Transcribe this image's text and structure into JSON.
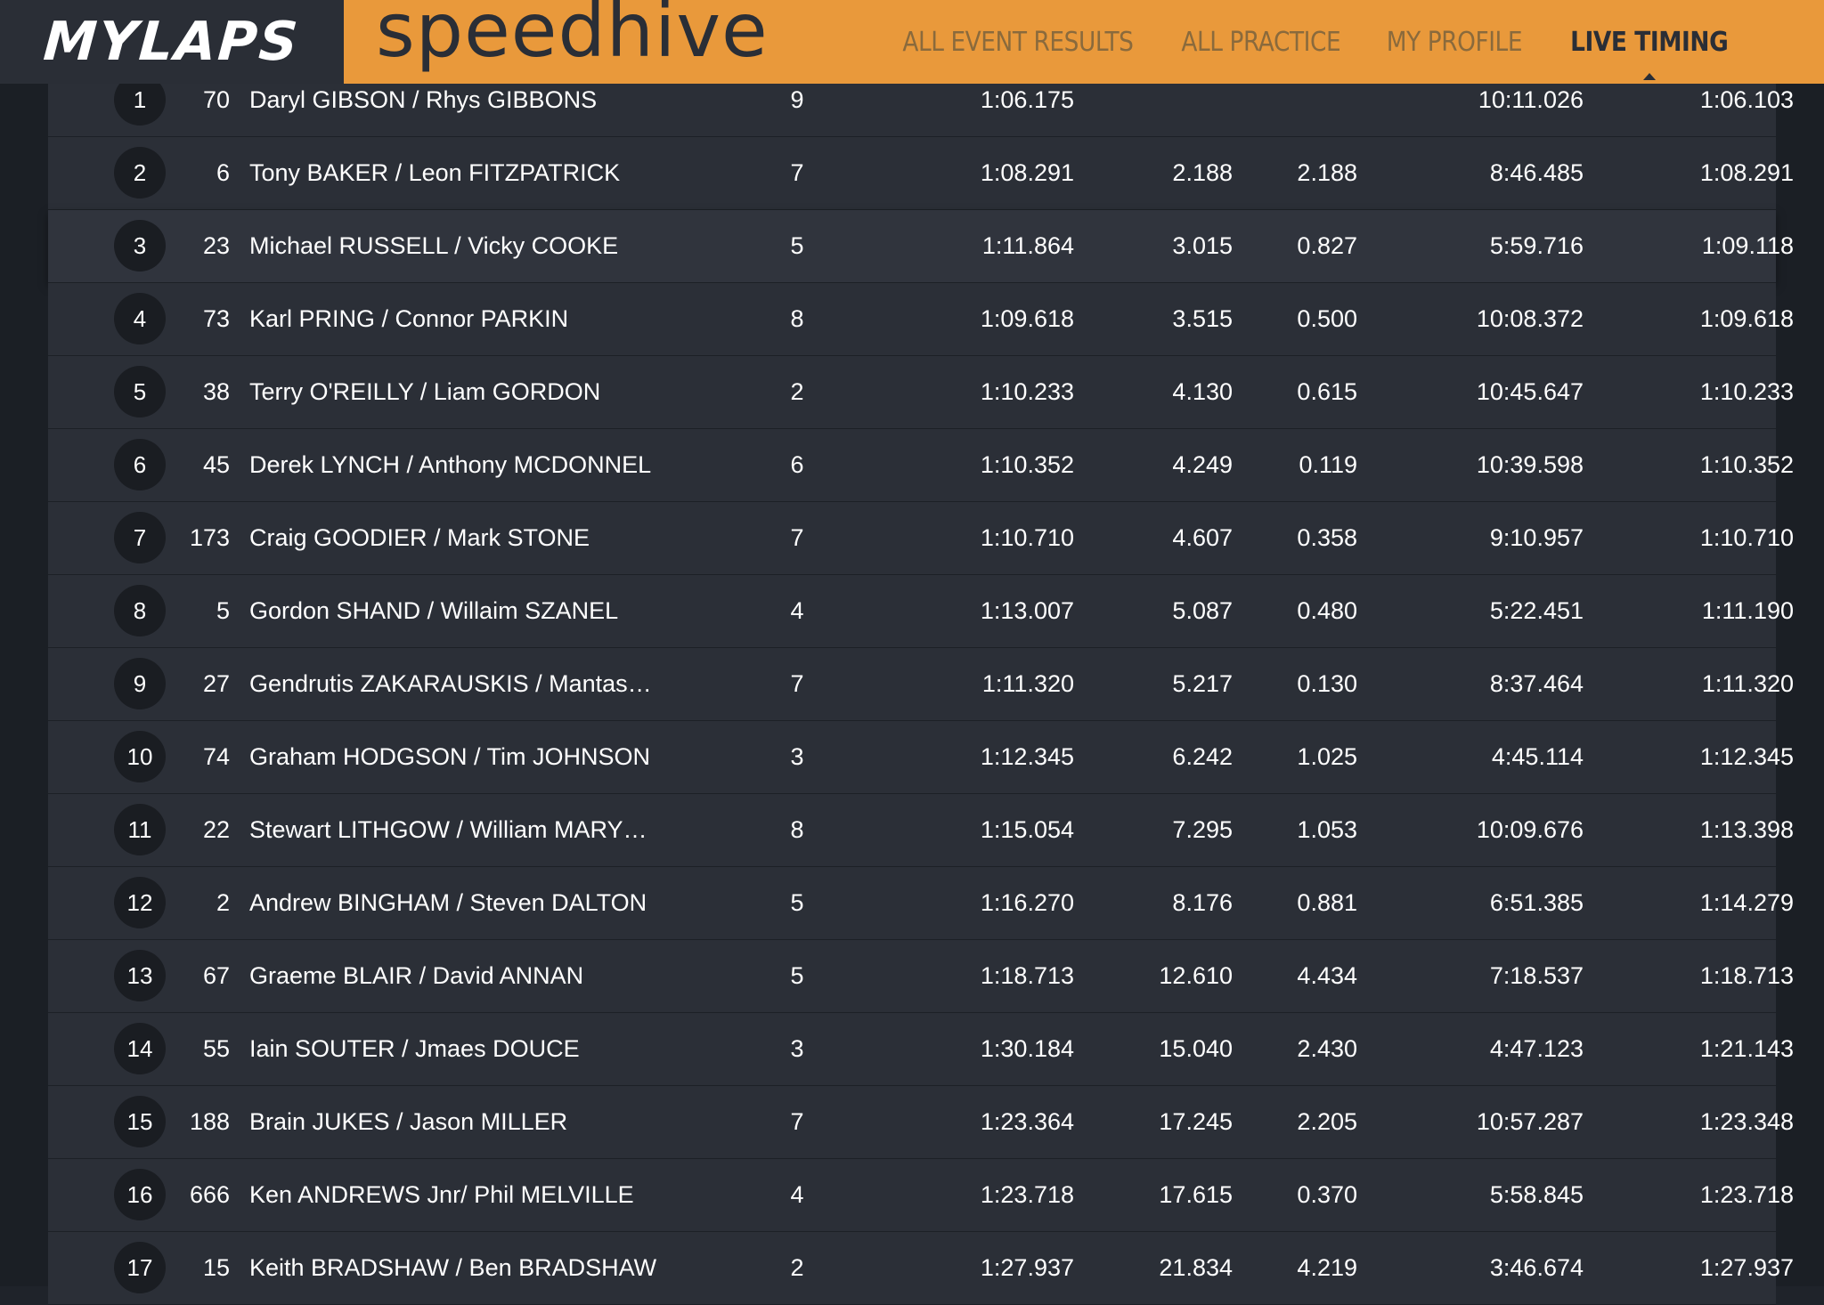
{
  "header": {
    "logo": "MYLAPS",
    "brand": "speedhive",
    "nav": [
      {
        "label": "ALL EVENT RESULTS",
        "active": false
      },
      {
        "label": "ALL PRACTICE",
        "active": false
      },
      {
        "label": "MY PROFILE",
        "active": false
      },
      {
        "label": "LIVE TIMING",
        "active": true
      }
    ]
  },
  "rows": [
    {
      "pos": "1",
      "num": "70",
      "name": "Daryl GIBSON / Rhys GIBBONS",
      "laps": "9",
      "best": "1:06.175",
      "gap": "",
      "diff": "",
      "total": "10:11.026",
      "last": "1:06.103"
    },
    {
      "pos": "2",
      "num": "6",
      "name": "Tony BAKER / Leon FITZPATRICK",
      "laps": "7",
      "best": "1:08.291",
      "gap": "2.188",
      "diff": "2.188",
      "total": "8:46.485",
      "last": "1:08.291"
    },
    {
      "pos": "3",
      "num": "23",
      "name": "Michael RUSSELL / Vicky COOKE",
      "laps": "5",
      "best": "1:11.864",
      "gap": "3.015",
      "diff": "0.827",
      "total": "5:59.716",
      "last": "1:09.118"
    },
    {
      "pos": "4",
      "num": "73",
      "name": "Karl PRING / Connor PARKIN",
      "laps": "8",
      "best": "1:09.618",
      "gap": "3.515",
      "diff": "0.500",
      "total": "10:08.372",
      "last": "1:09.618"
    },
    {
      "pos": "5",
      "num": "38",
      "name": "Terry O'REILLY / Liam GORDON",
      "laps": "2",
      "best": "1:10.233",
      "gap": "4.130",
      "diff": "0.615",
      "total": "10:45.647",
      "last": "1:10.233"
    },
    {
      "pos": "6",
      "num": "45",
      "name": "Derek LYNCH / Anthony MCDONNEL",
      "laps": "6",
      "best": "1:10.352",
      "gap": "4.249",
      "diff": "0.119",
      "total": "10:39.598",
      "last": "1:10.352"
    },
    {
      "pos": "7",
      "num": "173",
      "name": "Craig GOODIER / Mark STONE",
      "laps": "7",
      "best": "1:10.710",
      "gap": "4.607",
      "diff": "0.358",
      "total": "9:10.957",
      "last": "1:10.710"
    },
    {
      "pos": "8",
      "num": "5",
      "name": "Gordon SHAND / Willaim SZANEL",
      "laps": "4",
      "best": "1:13.007",
      "gap": "5.087",
      "diff": "0.480",
      "total": "5:22.451",
      "last": "1:11.190"
    },
    {
      "pos": "9",
      "num": "27",
      "name": "Gendrutis ZAKARAUSKIS / Mantas…",
      "laps": "7",
      "best": "1:11.320",
      "gap": "5.217",
      "diff": "0.130",
      "total": "8:37.464",
      "last": "1:11.320"
    },
    {
      "pos": "10",
      "num": "74",
      "name": "Graham HODGSON / Tim JOHNSON",
      "laps": "3",
      "best": "1:12.345",
      "gap": "6.242",
      "diff": "1.025",
      "total": "4:45.114",
      "last": "1:12.345"
    },
    {
      "pos": "11",
      "num": "22",
      "name": "Stewart LITHGOW / William MARY…",
      "laps": "8",
      "best": "1:15.054",
      "gap": "7.295",
      "diff": "1.053",
      "total": "10:09.676",
      "last": "1:13.398"
    },
    {
      "pos": "12",
      "num": "2",
      "name": "Andrew BINGHAM / Steven DALTON",
      "laps": "5",
      "best": "1:16.270",
      "gap": "8.176",
      "diff": "0.881",
      "total": "6:51.385",
      "last": "1:14.279"
    },
    {
      "pos": "13",
      "num": "67",
      "name": "Graeme BLAIR / David ANNAN",
      "laps": "5",
      "best": "1:18.713",
      "gap": "12.610",
      "diff": "4.434",
      "total": "7:18.537",
      "last": "1:18.713"
    },
    {
      "pos": "14",
      "num": "55",
      "name": "Iain SOUTER / Jmaes DOUCE",
      "laps": "3",
      "best": "1:30.184",
      "gap": "15.040",
      "diff": "2.430",
      "total": "4:47.123",
      "last": "1:21.143"
    },
    {
      "pos": "15",
      "num": "188",
      "name": "Brain JUKES / Jason MILLER",
      "laps": "7",
      "best": "1:23.364",
      "gap": "17.245",
      "diff": "2.205",
      "total": "10:57.287",
      "last": "1:23.348"
    },
    {
      "pos": "16",
      "num": "666",
      "name": "Ken ANDREWS Jnr/ Phil MELVILLE",
      "laps": "4",
      "best": "1:23.718",
      "gap": "17.615",
      "diff": "0.370",
      "total": "5:58.845",
      "last": "1:23.718"
    },
    {
      "pos": "17",
      "num": "15",
      "name": "Keith BRADSHAW / Ben BRADSHAW",
      "laps": "2",
      "best": "1:27.937",
      "gap": "21.834",
      "diff": "4.219",
      "total": "3:46.674",
      "last": "1:27.937"
    }
  ],
  "highlighted_row": 2
}
